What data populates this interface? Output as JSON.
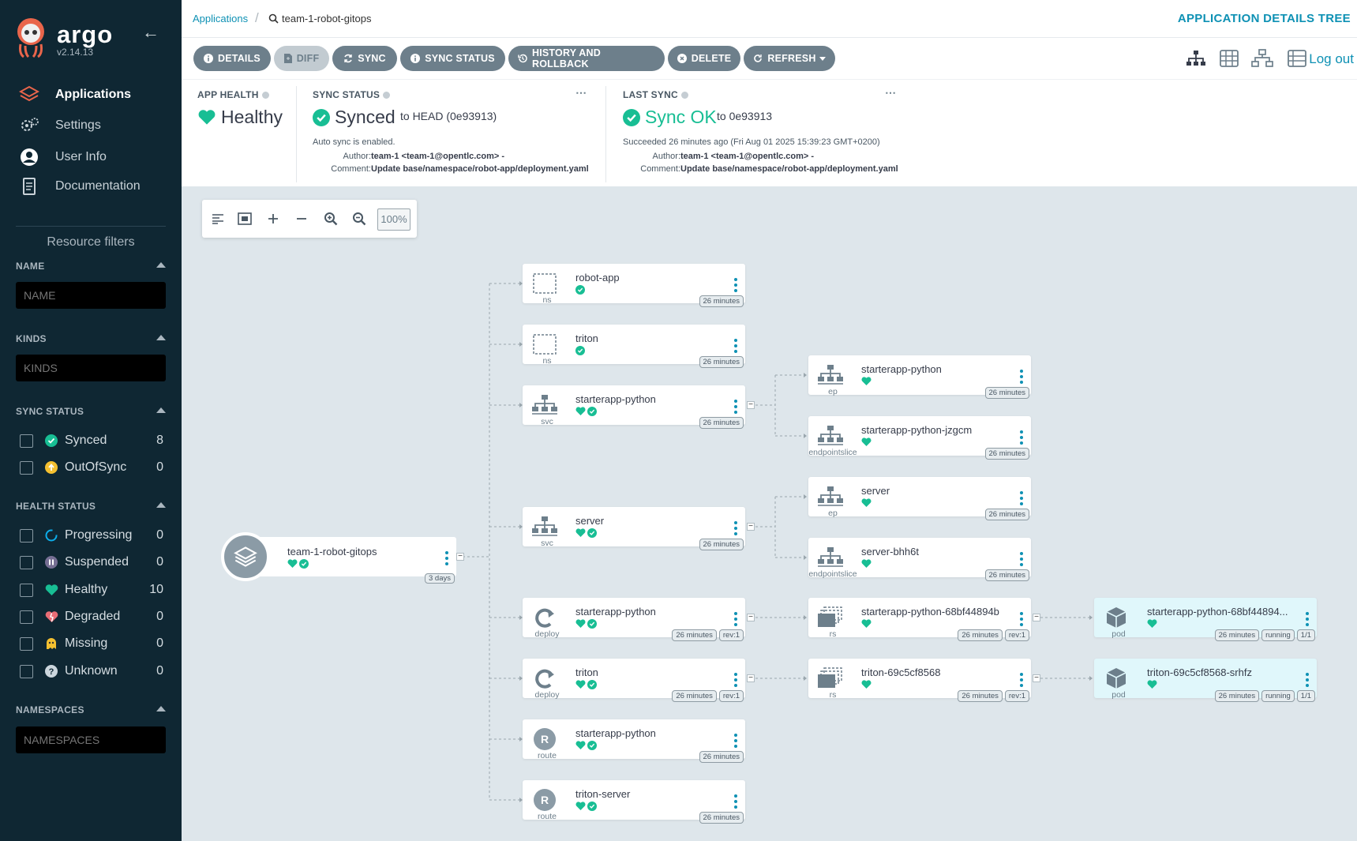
{
  "sidebar": {
    "brand": "argo",
    "version": "v2.14.13",
    "nav": [
      {
        "label": "Applications",
        "icon": "layers-icon"
      },
      {
        "label": "Settings",
        "icon": "gears-icon"
      },
      {
        "label": "User Info",
        "icon": "user-icon"
      },
      {
        "label": "Documentation",
        "icon": "book-icon"
      }
    ],
    "filters_title": "Resource filters",
    "name_section": "NAME",
    "name_placeholder": "NAME",
    "kinds_section": "KINDS",
    "kinds_placeholder": "KINDS",
    "sync_section": "SYNC STATUS",
    "sync_items": [
      {
        "label": "Synced",
        "count": "8",
        "color": "#18be94"
      },
      {
        "label": "OutOfSync",
        "count": "0",
        "color": "#f4c030"
      }
    ],
    "health_section": "HEALTH STATUS",
    "health_items": [
      {
        "label": "Progressing",
        "count": "0",
        "color": "#0dadea"
      },
      {
        "label": "Suspended",
        "count": "0",
        "color": "#766f94"
      },
      {
        "label": "Healthy",
        "count": "10",
        "color": "#18be94"
      },
      {
        "label": "Degraded",
        "count": "0",
        "color": "#e96d76"
      },
      {
        "label": "Missing",
        "count": "0",
        "color": "#f4c030"
      },
      {
        "label": "Unknown",
        "count": "0",
        "color": "#ccd6dd"
      }
    ],
    "namespaces_section": "NAMESPACES",
    "namespaces_placeholder": "NAMESPACES"
  },
  "topbar": {
    "breadcrumb_root": "Applications",
    "app_name": "team-1-robot-gitops",
    "page_title": "APPLICATION DETAILS TREE",
    "logout": "Log out"
  },
  "toolbar": {
    "details": "DETAILS",
    "diff": "DIFF",
    "sync": "SYNC",
    "sync_status": "SYNC STATUS",
    "history": "HISTORY AND ROLLBACK",
    "delete": "DELETE",
    "refresh": "REFRESH"
  },
  "status": {
    "app_health_label": "APP HEALTH",
    "app_health_value": "Healthy",
    "sync_status_label": "SYNC STATUS",
    "sync_status_value": "Synced",
    "sync_to": "to HEAD (0e93913)",
    "auto_sync": "Auto sync is enabled.",
    "author_label": "Author:",
    "author_value": "team-1 <team-1@opentlc.com> -",
    "comment_label": "Comment:",
    "comment_value": "Update base/namespace/robot-app/deployment.yaml",
    "last_sync_label": "LAST SYNC",
    "last_sync_value": "Sync OK",
    "last_sync_to": "to 0e93913",
    "succeeded": "Succeeded 26 minutes ago (Fri Aug 01 2025 15:39:23 GMT+0200)",
    "ls_author_value": "team-1 <team-1@opentlc.com> -",
    "ls_comment_value": "Update base/namespace/robot-app/deployment.yaml",
    "more": "⋯"
  },
  "graph": {
    "zoom": "100%",
    "app": {
      "name": "team-1-robot-gitops",
      "age": "3 days"
    },
    "col1": [
      {
        "name": "robot-app",
        "kind": "ns",
        "icon": "namespace-icon",
        "health": false,
        "tags": [
          "26 minutes"
        ]
      },
      {
        "name": "triton",
        "kind": "ns",
        "icon": "namespace-icon",
        "health": false,
        "tags": [
          "26 minutes"
        ]
      },
      {
        "name": "starterapp-python",
        "kind": "svc",
        "icon": "service-icon",
        "health": true,
        "tags": [
          "26 minutes"
        ]
      },
      {
        "name": "server",
        "kind": "svc",
        "icon": "service-icon",
        "health": true,
        "tags": [
          "26 minutes"
        ]
      },
      {
        "name": "starterapp-python",
        "kind": "deploy",
        "icon": "deployment-icon",
        "health": true,
        "tags": [
          "26 minutes",
          "rev:1"
        ]
      },
      {
        "name": "triton",
        "kind": "deploy",
        "icon": "deployment-icon",
        "health": true,
        "tags": [
          "26 minutes",
          "rev:1"
        ]
      },
      {
        "name": "starterapp-python",
        "kind": "route",
        "icon": "route-icon",
        "health": true,
        "tags": [
          "26 minutes"
        ]
      },
      {
        "name": "triton-server",
        "kind": "route",
        "icon": "route-icon",
        "health": true,
        "tags": [
          "26 minutes"
        ]
      }
    ],
    "col2": [
      {
        "name": "starterapp-python",
        "kind": "ep",
        "icon": "endpoint-icon",
        "tags": [
          "26 minutes"
        ]
      },
      {
        "name": "starterapp-python-jzgcm",
        "kind": "endpointslice",
        "icon": "endpoint-icon",
        "tags": [
          "26 minutes"
        ]
      },
      {
        "name": "server",
        "kind": "ep",
        "icon": "endpoint-icon",
        "tags": [
          "26 minutes"
        ]
      },
      {
        "name": "server-bhh6t",
        "kind": "endpointslice",
        "icon": "endpoint-icon",
        "tags": [
          "26 minutes"
        ]
      },
      {
        "name": "starterapp-python-68bf44894b",
        "kind": "rs",
        "icon": "replicaset-icon",
        "tags": [
          "26 minutes",
          "rev:1"
        ]
      },
      {
        "name": "triton-69c5cf8568",
        "kind": "rs",
        "icon": "replicaset-icon",
        "tags": [
          "26 minutes",
          "rev:1"
        ]
      }
    ],
    "col3": [
      {
        "name": "starterapp-python-68bf44894...",
        "kind": "pod",
        "icon": "pod-icon",
        "tags": [
          "26 minutes",
          "running",
          "1/1"
        ]
      },
      {
        "name": "triton-69c5cf8568-srhfz",
        "kind": "pod",
        "icon": "pod-icon",
        "tags": [
          "26 minutes",
          "running",
          "1/1"
        ]
      }
    ]
  },
  "colors": {
    "accent": "#0e91b4",
    "healthy": "#18be94",
    "sidebar": "#0f2733",
    "button": "#6d7f8b"
  }
}
